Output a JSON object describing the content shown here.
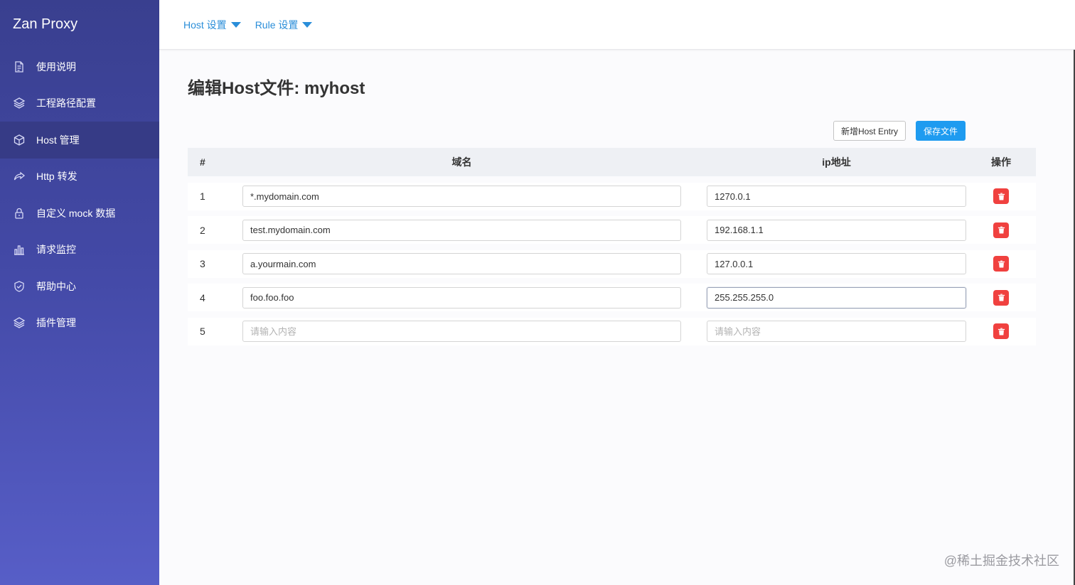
{
  "app": {
    "title": "Zan Proxy"
  },
  "sidebar": {
    "items": [
      {
        "label": "使用说明",
        "icon": "document-icon",
        "active": false
      },
      {
        "label": "工程路径配置",
        "icon": "layers-icon",
        "active": false
      },
      {
        "label": "Host 管理",
        "icon": "cube-icon",
        "active": true
      },
      {
        "label": "Http 转发",
        "icon": "share-forward-icon",
        "active": false
      },
      {
        "label": "自定义 mock 数据",
        "icon": "lock-icon",
        "active": false
      },
      {
        "label": "请求监控",
        "icon": "bar-chart-icon",
        "active": false
      },
      {
        "label": "帮助中心",
        "icon": "shield-icon",
        "active": false
      },
      {
        "label": "插件管理",
        "icon": "layers-icon",
        "active": false
      }
    ]
  },
  "topbar": {
    "menus": [
      {
        "label": "Host 设置"
      },
      {
        "label": "Rule 设置"
      }
    ]
  },
  "main": {
    "title": "编辑Host文件: myhost",
    "add_button": "新增Host Entry",
    "save_button": "保存文件",
    "table": {
      "headers": {
        "num": "#",
        "domain": "域名",
        "ip": "ip地址",
        "op": "操作"
      },
      "placeholder": "请输入内容",
      "rows": [
        {
          "num": "1",
          "domain": "*.mydomain.com",
          "ip": "1270.0.1"
        },
        {
          "num": "2",
          "domain": "test.mydomain.com",
          "ip": "192.168.1.1"
        },
        {
          "num": "3",
          "domain": "a.yourmain.com",
          "ip": "127.0.0.1"
        },
        {
          "num": "4",
          "domain": "foo.foo.foo",
          "ip": "255.255.255.0"
        },
        {
          "num": "5",
          "domain": "",
          "ip": ""
        }
      ]
    }
  },
  "watermark": "@稀土掘金技术社区",
  "colors": {
    "accent": "#1e9bf0",
    "danger": "#f0413f",
    "sidebar_top": "#393f8f",
    "sidebar_bottom": "#575ec7",
    "link": "#2a8ed9"
  }
}
